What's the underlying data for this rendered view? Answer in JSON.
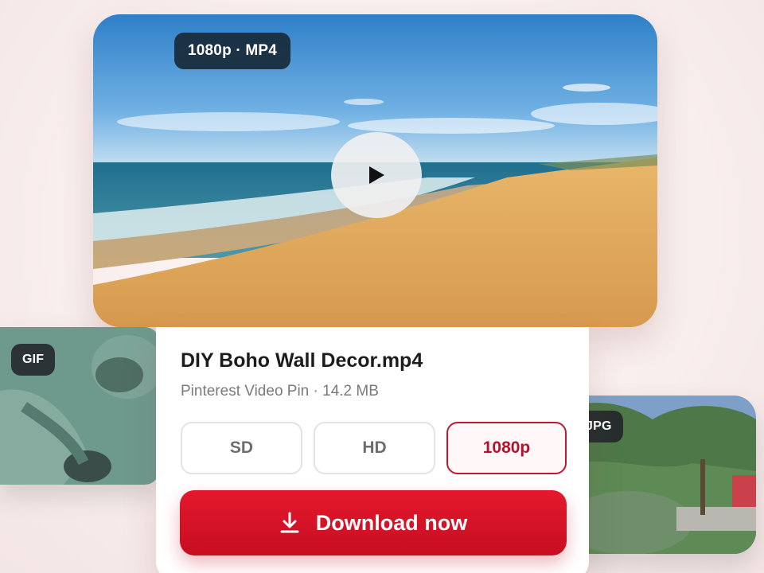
{
  "hero": {
    "format_badge": "1080p · MP4",
    "play_icon": "play-icon"
  },
  "gif_card": {
    "badge": "GIF"
  },
  "jpg_card": {
    "badge": "JPG"
  },
  "file": {
    "name": "DIY Boho Wall Decor.mp4",
    "source": "Pinterest Video Pin",
    "separator": "·",
    "size": "14.2 MB"
  },
  "quality_options": [
    {
      "label": "SD",
      "selected": false
    },
    {
      "label": "HD",
      "selected": false
    },
    {
      "label": "1080p",
      "selected": true
    }
  ],
  "download": {
    "label": "Download now",
    "icon": "download-icon"
  },
  "colors": {
    "accent": "#D3122A",
    "badge_dark": "#1B2B36",
    "selected_border": "#C0182F"
  }
}
